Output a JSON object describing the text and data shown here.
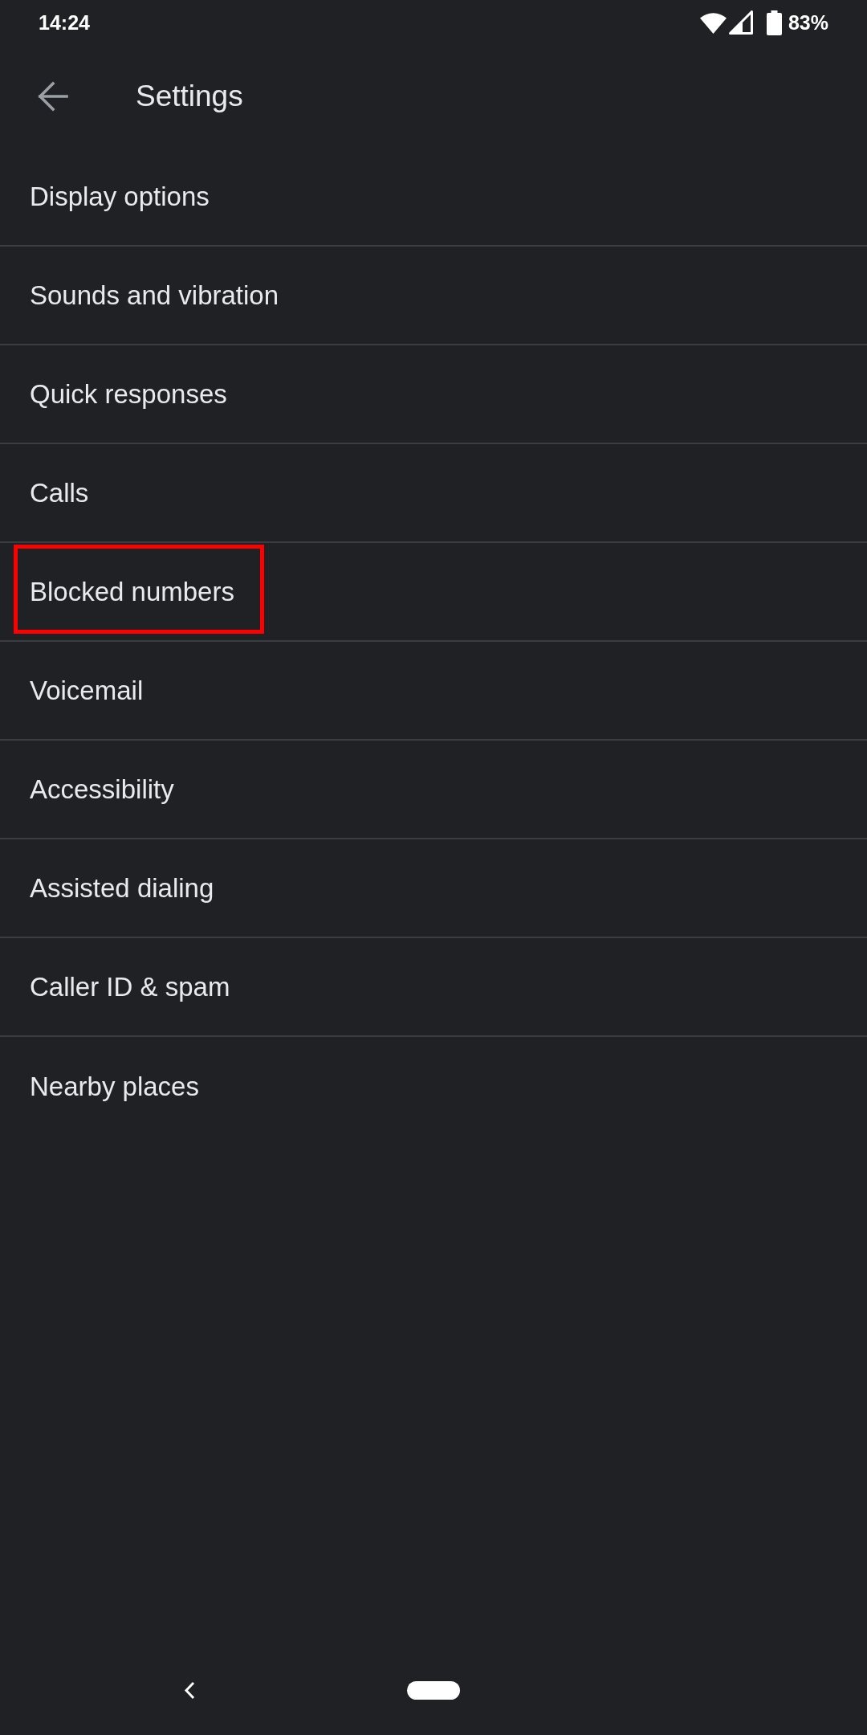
{
  "status_bar": {
    "time": "14:24",
    "battery": "83%"
  },
  "app_bar": {
    "title": "Settings"
  },
  "items": [
    {
      "label": "Display options",
      "highlighted": false
    },
    {
      "label": "Sounds and vibration",
      "highlighted": false
    },
    {
      "label": "Quick responses",
      "highlighted": false
    },
    {
      "label": "Calls",
      "highlighted": false
    },
    {
      "label": "Blocked numbers",
      "highlighted": true
    },
    {
      "label": "Voicemail",
      "highlighted": false
    },
    {
      "label": "Accessibility",
      "highlighted": false
    },
    {
      "label": "Assisted dialing",
      "highlighted": false
    },
    {
      "label": "Caller ID & spam",
      "highlighted": false
    },
    {
      "label": "Nearby places",
      "highlighted": false
    }
  ]
}
